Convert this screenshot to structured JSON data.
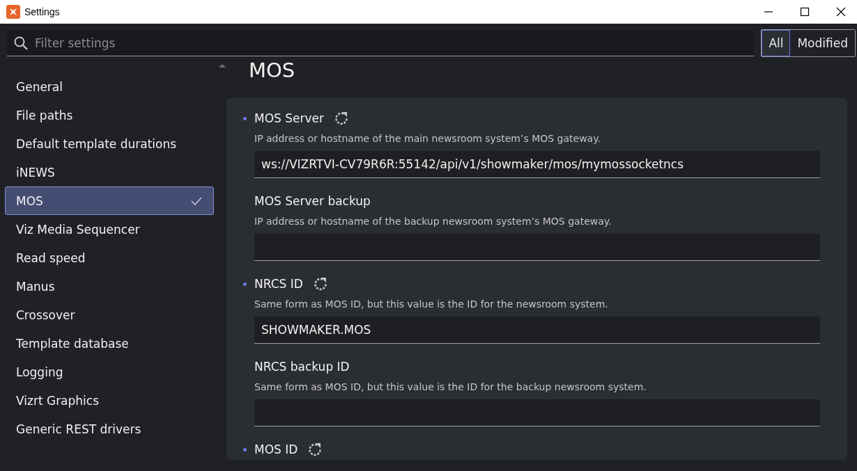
{
  "window": {
    "title": "Settings"
  },
  "filter": {
    "placeholder": "Filter settings",
    "options": [
      {
        "label": "All",
        "selected": true
      },
      {
        "label": "Modified",
        "selected": false
      }
    ]
  },
  "sidebar": {
    "items": [
      {
        "label": "General",
        "selected": false
      },
      {
        "label": "File paths",
        "selected": false
      },
      {
        "label": "Default template durations",
        "selected": false
      },
      {
        "label": "iNEWS",
        "selected": false
      },
      {
        "label": "MOS",
        "selected": true
      },
      {
        "label": "Viz Media Sequencer",
        "selected": false
      },
      {
        "label": "Read speed",
        "selected": false
      },
      {
        "label": "Manus",
        "selected": false
      },
      {
        "label": "Crossover",
        "selected": false
      },
      {
        "label": "Template database",
        "selected": false
      },
      {
        "label": "Logging",
        "selected": false
      },
      {
        "label": "Vizrt Graphics",
        "selected": false
      },
      {
        "label": "Generic REST drivers",
        "selected": false
      }
    ]
  },
  "section": {
    "heading": "MOS",
    "settings": [
      {
        "title": "MOS Server",
        "modified": true,
        "description": "IP address or hostname of the main newsroom system’s MOS gateway.",
        "kind": "text-field",
        "value": "ws://VIZRTVI-CV79R6R:55142/api/v1/showmaker/mos/mymossocketncs"
      },
      {
        "title": "MOS Server backup",
        "modified": false,
        "description": "IP address or hostname of the backup newsroom system’s MOS gateway.",
        "kind": "text-field"
      },
      {
        "title": "NRCS ID",
        "modified": true,
        "description": "Same form as MOS ID, but this value is the ID for the newsroom system.",
        "kind": "text-field",
        "value": "SHOWMAKER.MOS"
      },
      {
        "title": "NRCS backup ID",
        "modified": false,
        "description": "Same form as MOS ID, but this value is the ID for the backup newsroom system.",
        "kind": "text-field"
      },
      {
        "title": "MOS ID",
        "modified": true
      }
    ]
  }
}
